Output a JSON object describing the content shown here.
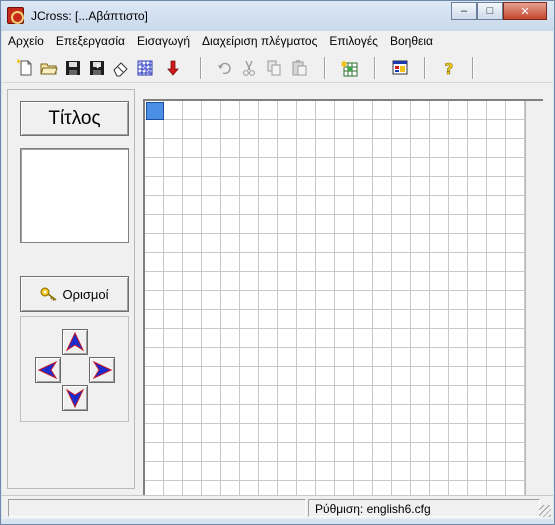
{
  "window": {
    "title": "JCross: [...Αβάπτιστο]"
  },
  "titlebar": {
    "minimize": "–",
    "maximize": "□",
    "close": "✕"
  },
  "menu": [
    "Αρχείο",
    "Επεξεργασία",
    "Εισαγωγή",
    "Διαχείριση πλέγματος",
    "Επιλογές",
    "Βοηθεια"
  ],
  "toolbar": {
    "buttons": [
      {
        "icon": "new-file-icon"
      },
      {
        "icon": "open-folder-icon"
      },
      {
        "icon": "save-icon"
      },
      {
        "icon": "save-as-icon"
      },
      {
        "icon": "eraser-icon"
      },
      {
        "icon": "grid-pattern-icon"
      },
      {
        "icon": "down-arrow-icon"
      },
      {
        "icon": "undo-icon"
      },
      {
        "icon": "cut-icon"
      },
      {
        "icon": "copy-icon"
      },
      {
        "icon": "paste-icon"
      },
      {
        "icon": "grid-wizard-icon"
      },
      {
        "icon": "web-export-icon"
      },
      {
        "icon": "help-icon"
      }
    ]
  },
  "sidepanel": {
    "title_button": "Τίτλος",
    "definitions_button": "Ορισμοί",
    "arrows": [
      "up",
      "left",
      "right",
      "down"
    ]
  },
  "grid": {
    "columns": 20,
    "rows": 21,
    "cursor": [
      0,
      0
    ]
  },
  "status": {
    "setting": "Ρύθμιση: english6.cfg"
  },
  "colors": {
    "accent": "#4a8ee6",
    "arrow_fill": "#1a2bd0",
    "arrow_edge": "#c0162a"
  }
}
